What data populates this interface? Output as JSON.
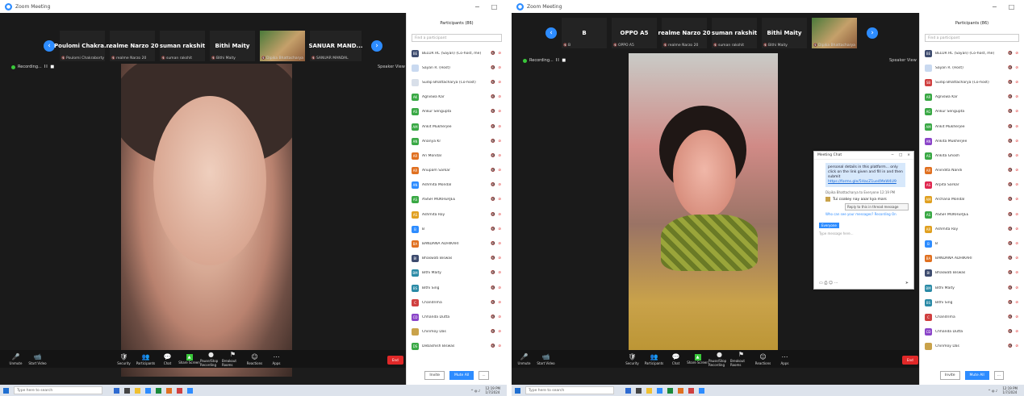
{
  "left": {
    "window_title": "Zoom Meeting",
    "window_controls": [
      "−",
      "□",
      "×"
    ],
    "gallery": [
      {
        "label": "Poulomi Chakra...",
        "name": "Poulomi Chakraborty"
      },
      {
        "label": "realme Narzo 20",
        "name": "realme Narzo 20"
      },
      {
        "label": "suman rakshit",
        "name": "suman rakshit"
      },
      {
        "label": "Bithi Maity",
        "name": "Bithi Maity"
      },
      {
        "label": "",
        "name": "Dipika Bhattacharya"
      },
      {
        "label": "SANUAR MAND...",
        "name": "SANUAR MANDAL"
      }
    ],
    "recording": "Recording...",
    "pause_stop": "II ■",
    "view": "Speaker View",
    "active_name": "Dipika Bhattacharya",
    "panel_title": "Participants (86)",
    "search_placeholder": "Find a participant",
    "participants": [
      {
        "initials": "BE",
        "name": "BELUR RC (Sayan) (Co-host, me)",
        "color": "#3d4b6e",
        "icons": "🔇 ⊘"
      },
      {
        "initials": "",
        "name": "Sayan R. (Host)",
        "color": "#c9d9f0",
        "icons": "🔇 ⊘"
      },
      {
        "initials": "",
        "name": "Sudip Bhattacharya (Co-host)",
        "color": "#d8dfe9",
        "icons": "🔇 ⊘"
      },
      {
        "initials": "AK",
        "name": "Agniswa Kar",
        "color": "#39a844",
        "icons": "🔇 ⊘"
      },
      {
        "initials": "AS",
        "name": "Ankur Sengupta",
        "color": "#39a844",
        "icons": "🔇 ⊘"
      },
      {
        "initials": "AM",
        "name": "Ankit Mukherjee",
        "color": "#39a844",
        "icons": "🔇 ⊘"
      },
      {
        "initials": "AN",
        "name": "Ananya Kr",
        "color": "#39a844",
        "icons": "🔇 ⊘"
      },
      {
        "initials": "AR",
        "name": "Ari Mondal",
        "color": "#e07020",
        "icons": "🔇 ⊘"
      },
      {
        "initials": "AR",
        "name": "Anupam Sarkar",
        "color": "#e07020",
        "icons": "🔇 ⊘"
      },
      {
        "initials": "AN",
        "name": "Ashmita Mondal",
        "color": "#2d8cff",
        "icons": "🔇 ⊘"
      },
      {
        "initials": "AS",
        "name": "ASISH MUKHERJEE",
        "color": "#39a844",
        "icons": "🔇 ⊘"
      },
      {
        "initials": "AS",
        "name": "Ashmita Roy",
        "color": "#e0a020",
        "icons": "🔇 ⊘"
      },
      {
        "initials": "B",
        "name": "B",
        "color": "#2d8cff",
        "icons": "🔇 ⊘"
      },
      {
        "initials": "BA",
        "name": "BANDANA ADHIKARI",
        "color": "#e07020",
        "icons": "🔇 ⊘"
      },
      {
        "initials": "BI",
        "name": "Bhaswati Biswas",
        "color": "#3d4b6e",
        "icons": "🔇 ⊘"
      },
      {
        "initials": "BM",
        "name": "Bithi Maity",
        "color": "#2a8aa6",
        "icons": "🔇 ⊘"
      },
      {
        "initials": "BS",
        "name": "Bithi Sing",
        "color": "#2a8aa6",
        "icons": "🔇 ⊘"
      },
      {
        "initials": "C",
        "name": "Chandrima",
        "color": "#d04040",
        "icons": "🔇 ⊘"
      },
      {
        "initials": "CD",
        "name": "Chhanda Dutta",
        "color": "#8a44c8",
        "icons": "🔇 ⊘"
      },
      {
        "initials": "",
        "name": "Chinmoy Das",
        "color": "#c9a24a",
        "icons": "🔇 ⊘"
      },
      {
        "initials": "DS",
        "name": "Debashish Biswas",
        "color": "#39a844",
        "icons": "🔇 ⊘"
      }
    ],
    "invite": "Invite",
    "mute_all": "Mute All",
    "more": "..."
  },
  "right": {
    "window_title": "Zoom Meeting",
    "window_controls": [
      "−",
      "□",
      "×"
    ],
    "gallery": [
      {
        "label": "B",
        "name": "B"
      },
      {
        "label": "OPPO A5",
        "name": "OPPO A5"
      },
      {
        "label": "realme Narzo 20",
        "name": "realme Narzo 20"
      },
      {
        "label": "suman rakshit",
        "name": "suman rakshit"
      },
      {
        "label": "Bithi Maity",
        "name": "Bithi Maity"
      },
      {
        "label": "",
        "name": "Dipika Bhattacharya"
      }
    ],
    "recording": "Recording...",
    "pause_stop": "II ■",
    "view": "Speaker View",
    "active_name": "Anindita Nandi",
    "panel_title": "Participants (86)",
    "search_placeholder": "Find a participant",
    "participants": [
      {
        "initials": "BE",
        "name": "BELUR RC (Sayan) (Co-host, me)",
        "color": "#3d4b6e",
        "icons": "🔇 ⊘"
      },
      {
        "initials": "",
        "name": "Sayan R. (Host)",
        "color": "#c9d9f0",
        "icons": "🔇 ⊘"
      },
      {
        "initials": "SB",
        "name": "Sudip Bhattacharya (Co-host)",
        "color": "#d04040",
        "icons": "🔇 ⊘"
      },
      {
        "initials": "AR",
        "name": "Agniswa Kar",
        "color": "#39a844",
        "icons": "🔇 ⊘"
      },
      {
        "initials": "AG",
        "name": "Ankur Sengupta",
        "color": "#39a844",
        "icons": "🔇 ⊘"
      },
      {
        "initials": "AM",
        "name": "Ankit Mukherjee",
        "color": "#39a844",
        "icons": "🔇 ⊘"
      },
      {
        "initials": "AN",
        "name": "Ankita Mukherjee",
        "color": "#8a44c8",
        "icons": "🔇 ⊘"
      },
      {
        "initials": "AS",
        "name": "Ankita Ghosh",
        "color": "#39a844",
        "icons": "🔇 ⊘"
      },
      {
        "initials": "AR",
        "name": "Anindita Nandi",
        "color": "#e07020",
        "icons": "🔇 ⊘"
      },
      {
        "initials": "AS",
        "name": "Arpita Sarkar",
        "color": "#e02850",
        "icons": "🔇 ⊘"
      },
      {
        "initials": "AM",
        "name": "Archana Mondal",
        "color": "#e0a020",
        "icons": "🔇 ⊘"
      },
      {
        "initials": "AS",
        "name": "ASISH MUKHERJEE",
        "color": "#39a844",
        "icons": "🔇 ⊘"
      },
      {
        "initials": "AR",
        "name": "Ashmita Roy",
        "color": "#e0a020",
        "icons": "🔇 ⊘"
      },
      {
        "initials": "B",
        "name": "B",
        "color": "#2d8cff",
        "icons": "🔇 ⊘"
      },
      {
        "initials": "BA",
        "name": "BANDANA ADHIKARI",
        "color": "#e07020",
        "icons": "🔇 ⊘"
      },
      {
        "initials": "BI",
        "name": "Bhaswati Biswas",
        "color": "#3d4b6e",
        "icons": "🔇 ⊘"
      },
      {
        "initials": "BM",
        "name": "Bithi Maity",
        "color": "#2a8aa6",
        "icons": "🔇 ⊘"
      },
      {
        "initials": "BS",
        "name": "Bithi Sing",
        "color": "#2a8aa6",
        "icons": "🔇 ⊘"
      },
      {
        "initials": "C",
        "name": "Chandrima",
        "color": "#d04040",
        "icons": "🔇 ⊘"
      },
      {
        "initials": "CD",
        "name": "Chhanda Dutta",
        "color": "#8a44c8",
        "icons": "🔇 ⊘"
      },
      {
        "initials": "",
        "name": "Chinmoy Das",
        "color": "#c9a24a",
        "icons": "🔇 ⊘"
      }
    ],
    "invite": "Invite",
    "mute_all": "Mute All",
    "more": "...",
    "chat": {
      "title": "Meeting Chat",
      "controls": [
        "−",
        "□",
        "×"
      ],
      "message": "personal details in this platform... only click on the link given and fill in and then submit",
      "link": "https://forms.gle/5HacZ1ue4MeW4U9",
      "sender": "Dipika Bhattacharya to Everyone 12:19 PM",
      "reply_text": "Tui coakey nay aaar kya mars",
      "reply_button": "Reply to this in thread message",
      "who_can_see": "Who can see your messages? Recording On",
      "to_label": "Everyone",
      "placeholder": "Type message here..."
    }
  },
  "toolbar": [
    {
      "icon": "🎤",
      "label": "Unmute"
    },
    {
      "icon": "📹",
      "label": "Start Video"
    },
    {
      "icon": "🛡",
      "label": "Security"
    },
    {
      "icon": "👥",
      "label": "Participants"
    },
    {
      "icon": "💬",
      "label": "Chat"
    },
    {
      "icon": "▲",
      "label": "Share Screen"
    },
    {
      "icon": "●",
      "label": "Pause/Stop Recording"
    },
    {
      "icon": "⚑",
      "label": "Breakout Rooms"
    },
    {
      "icon": "☺",
      "label": "Reactions"
    },
    {
      "icon": "⋯",
      "label": "Apps"
    }
  ],
  "end_label": "End",
  "taskbar": {
    "search_placeholder": "Type here to search",
    "time": "12:19 PM",
    "date": "1/7/2024"
  }
}
